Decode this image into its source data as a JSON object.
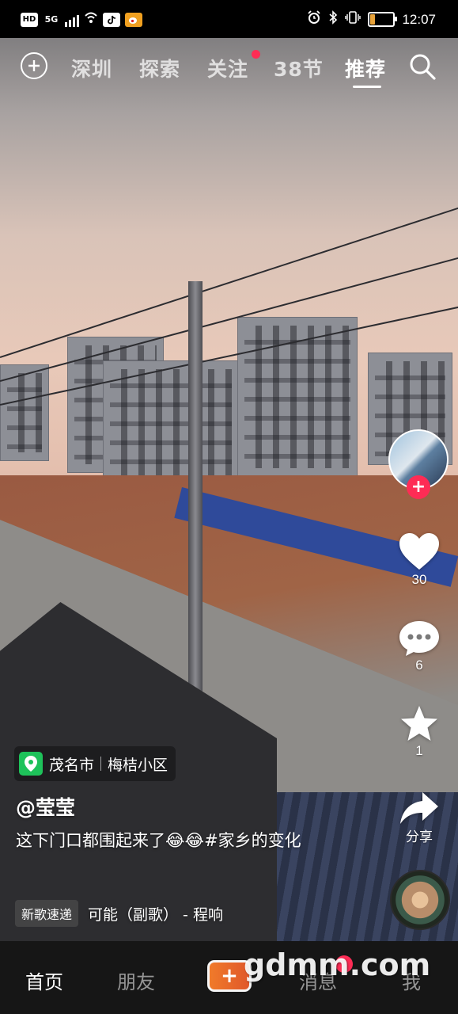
{
  "status_bar": {
    "left_chips": [
      "HD",
      "5G"
    ],
    "icons": [
      "signal-icon",
      "wifi-icon",
      "tiktok-icon",
      "weibo-icon"
    ],
    "right_icons": [
      "alarm-icon",
      "bluetooth-icon",
      "vibrate-icon",
      "battery-icon"
    ],
    "battery_level": 0.2,
    "time": "12:07"
  },
  "top_nav": {
    "tabs": [
      {
        "label": "深圳"
      },
      {
        "label": "探索"
      },
      {
        "label": "关注",
        "has_dot": true
      },
      {
        "label": "38节"
      },
      {
        "label": "推荐",
        "active": true
      }
    ]
  },
  "actions": {
    "likes": "30",
    "comments": "6",
    "favorites": "1",
    "share_label": "分享"
  },
  "location": {
    "city": "茂名市",
    "place": "梅桔小区"
  },
  "post": {
    "author": "@莹莹",
    "caption": "这下门口都围起来了😂😂#家乡的变化"
  },
  "music": {
    "tag": "新歌速递",
    "title": "可能（副歌） - 程响"
  },
  "bottom_nav": {
    "items": [
      "首页",
      "朋友",
      "消息",
      "我"
    ],
    "plus_label": "+"
  },
  "watermark": "gdmm.com",
  "colors": {
    "accent_red": "#fe2c55",
    "location_green": "#1ec25a",
    "plus_orange": "#f07a2a"
  }
}
